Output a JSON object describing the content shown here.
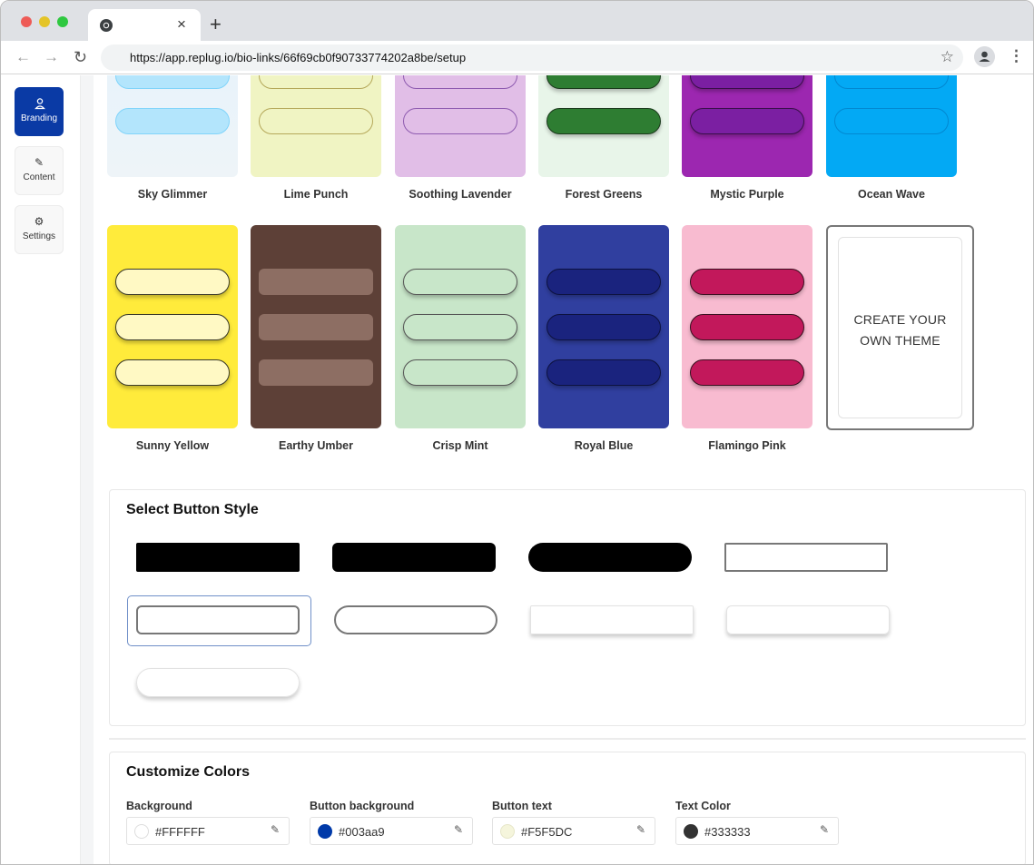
{
  "browser": {
    "url": "https://app.replug.io/bio-links/66f69cb0f90733774202a8be/setup",
    "tab_close": "×",
    "new_tab": "+",
    "back": "←",
    "forward": "→",
    "reload": "↻",
    "bookmark": "☆",
    "menu": "⋮"
  },
  "sidebar": {
    "items": [
      {
        "label": "Branding",
        "icon": "user-icon",
        "glyph": "👤",
        "active": true
      },
      {
        "label": "Content",
        "icon": "pencil-icon",
        "glyph": "✎",
        "active": false
      },
      {
        "label": "Settings",
        "icon": "gear-icon",
        "glyph": "⚙",
        "active": false
      }
    ]
  },
  "themes": [
    {
      "name": "Sky Glimmer",
      "bg": "#e3f2fd",
      "button": "#b3e5fc",
      "border": "#81d4fa"
    },
    {
      "name": "Lime Punch",
      "bg": "#f0f4c3",
      "button": "#f0f4c3",
      "border": "#b5a85a"
    },
    {
      "name": "Soothing Lavender",
      "bg": "#e1bee7",
      "button": "#e1bee7",
      "border": "#8e5bb0"
    },
    {
      "name": "Forest Greens",
      "bg": "#e8f5e9",
      "button": "#2e7d32",
      "border": "#1b3a1c"
    },
    {
      "name": "Mystic Purple",
      "bg": "#9c27b0",
      "button": "#7b1fa2",
      "border": "#3a0f4a"
    },
    {
      "name": "Ocean Wave",
      "bg": "#03a9f4",
      "button": "#03a9f4",
      "border": "#0288d1"
    },
    {
      "name": "Sunny Yellow",
      "bg": "#ffeb3b",
      "button": "#fff9c4",
      "border": "#3a3a2a"
    },
    {
      "name": "Earthy Umber",
      "bg": "#5d4037",
      "button": "#8d6e63",
      "border": "#8d6e63"
    },
    {
      "name": "Crisp Mint",
      "bg": "#c8e6c9",
      "button": "#c8e6c9",
      "border": "#555"
    },
    {
      "name": "Royal Blue",
      "bg": "#303f9f",
      "button": "#1a237e",
      "border": "#0d1240"
    },
    {
      "name": "Flamingo Pink",
      "bg": "#f8bbd0",
      "button": "#c2185b",
      "border": "#3a1020"
    }
  ],
  "create_theme": {
    "line1": "CREATE YOUR",
    "line2": "OWN THEME"
  },
  "button_style": {
    "title": "Select Button Style",
    "selected_index": 4
  },
  "customize_colors": {
    "title": "Customize Colors",
    "fields": [
      {
        "label": "Background",
        "value": "#FFFFFF",
        "swatch": "#ffffff"
      },
      {
        "label": "Button background",
        "value": "#003aa9",
        "swatch": "#003aa9"
      },
      {
        "label": "Button text",
        "value": "#F5F5DC",
        "swatch": "#f5f5dc"
      },
      {
        "label": "Text Color",
        "value": "#333333",
        "swatch": "#333333"
      }
    ]
  }
}
